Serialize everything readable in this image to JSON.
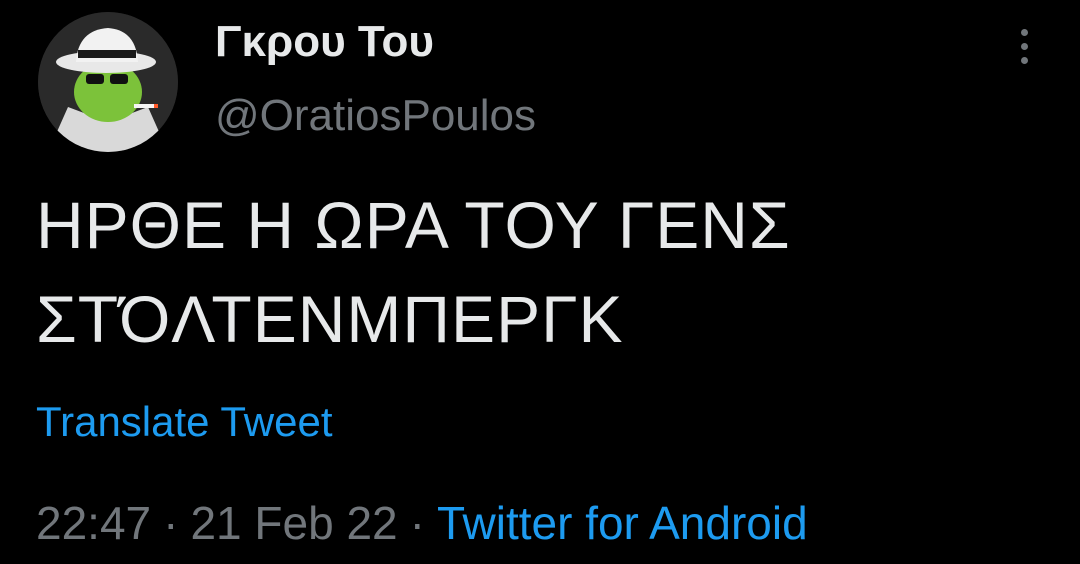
{
  "user": {
    "display_name": "Γκρου Του",
    "handle": "@OratiosPoulos",
    "avatar_icon": "avatar-icon"
  },
  "tweet": {
    "text_lines": [
      "ΗΡΘΕ Η ΩΡΑ ΤΟΥ ΓΕΝΣ",
      "ΣΤΌΛΤΕΝΜΠΕΡΓΚ"
    ],
    "translate_label": "Translate Tweet",
    "time": "22:47",
    "date": "21 Feb 22",
    "separator": "·",
    "source": "Twitter for Android"
  },
  "menu": {
    "icon": "more-options-icon"
  },
  "colors": {
    "background": "#000000",
    "text": "#e7e9ea",
    "muted": "#71767b",
    "accent": "#1d9bf0"
  }
}
